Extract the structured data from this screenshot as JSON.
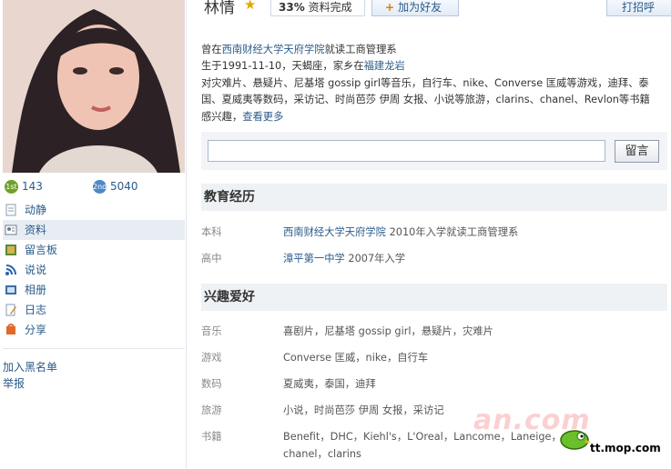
{
  "profile": {
    "name": "林情",
    "completion": "33%",
    "completion_label": "资料完成",
    "add_friend": "加为好友",
    "print": "打招呼"
  },
  "stats": {
    "level1": "1st",
    "value1": "143",
    "level2": "2nd",
    "value2": "5040"
  },
  "nav": [
    {
      "label": "动静",
      "icon": "note-icon"
    },
    {
      "label": "资料",
      "icon": "profile-icon"
    },
    {
      "label": "留言板",
      "icon": "picture-board-icon"
    },
    {
      "label": "说说",
      "icon": "rss-icon"
    },
    {
      "label": "相册",
      "icon": "album-icon"
    },
    {
      "label": "日志",
      "icon": "pencil-icon"
    },
    {
      "label": "分享",
      "icon": "share-icon"
    }
  ],
  "sidebar_links": {
    "blacklist": "加入黑名单",
    "report": "举报"
  },
  "intro": {
    "line1_prefix": "曾在",
    "line1_school": "西南财经大学天府学院",
    "line1_suffix": "就读工商管理系",
    "line2_prefix": "生于1991-11-10，天蝎座，家乡在",
    "line2_home": "福建龙岩",
    "line3": "对灾难片、悬疑片、尼基塔 gossip girl等音乐，自行车、nike、Converse 匡威等游戏，迪拜、泰",
    "line4": "国、夏威夷等数码，采访记、时尚芭莎 伊周 女报、小说等旅游，clarins、chanel、Revlon等书籍",
    "line5_prefix": "感兴趣，",
    "line5_more": "查看更多"
  },
  "message": {
    "button": "留言"
  },
  "education": {
    "title": "教育经历",
    "rows": [
      {
        "label": "本科",
        "link": "西南财经大学天府学院",
        "text": " 2010年入学就读工商管理系"
      },
      {
        "label": "高中",
        "link": "漳平第一中学",
        "text": " 2007年入学"
      }
    ]
  },
  "hobbies": {
    "title": "兴趣爱好",
    "rows": [
      {
        "label": "音乐",
        "text": "喜剧片，尼基塔 gossip girl，悬疑片，灾难片"
      },
      {
        "label": "游戏",
        "text": "Converse 匡威，nike，自行车"
      },
      {
        "label": "数码",
        "text": "夏威夷，泰国，迪拜"
      },
      {
        "label": "旅游",
        "text": "小说，时尚芭莎 伊周 女报，采访记"
      },
      {
        "label": "书籍",
        "text": "Benefit，DHC，Kiehl's，L'Oreal，Lancome，Laneige，",
        "text2": "chanel，clarins"
      }
    ]
  },
  "watermarks": {
    "site": "an.com",
    "domain": "tt.mop.com"
  },
  "colors": {
    "link": "#2a5b8a",
    "section_bg": "#eff2f5",
    "accent_star": "#e0a800"
  }
}
